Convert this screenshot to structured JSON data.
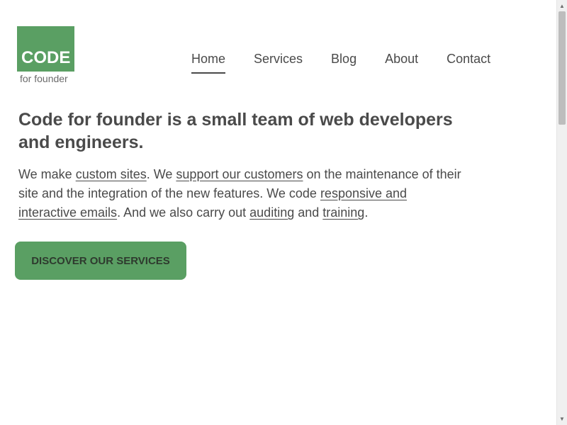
{
  "logo": {
    "mark": "CODE",
    "tagline": "for founder"
  },
  "nav": {
    "items": [
      {
        "label": "Home"
      },
      {
        "label": "Services"
      },
      {
        "label": "Blog"
      },
      {
        "label": "About"
      },
      {
        "label": "Contact"
      }
    ],
    "active": "Home"
  },
  "hero": {
    "headline": "Code for founder is a small team of web developers and engineers.",
    "intro": {
      "t1": "We make ",
      "link1": "custom sites",
      "t2": ". We ",
      "link2": "support our customers",
      "t3": " on the maintenance of their site and the integration of the new features. We code ",
      "link3": "responsive and interactive emails",
      "t4": ". And we also carry out ",
      "link4": "auditing",
      "t5": " and ",
      "link5": "training",
      "t6": "."
    },
    "cta_label": "DISCOVER OUR SERVICES"
  },
  "colors": {
    "brand": "#5a9f63",
    "text": "#4a4a4a"
  },
  "scrollbar": {
    "up_icon": "triangle-up-icon",
    "down_icon": "triangle-down-icon"
  }
}
